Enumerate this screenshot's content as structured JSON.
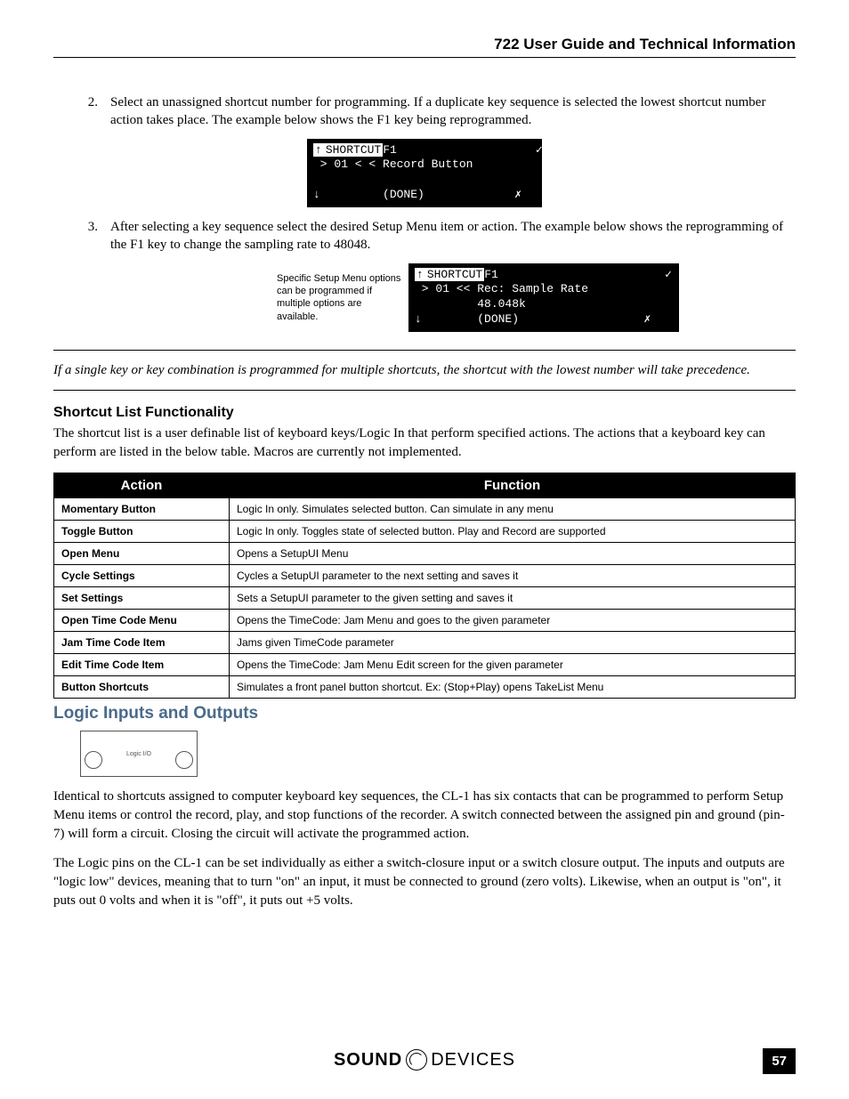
{
  "header_title": "722 User Guide and Technical Information",
  "steps": [
    {
      "num": "2.",
      "text": "Select an unassigned shortcut number for programming. If a duplicate key sequence is selected the lowest shortcut number action takes place. The example below shows the F1 key being reprogrammed."
    },
    {
      "num": "3.",
      "text": "After selecting a key sequence select the desired Setup Menu item or action. The example below shows the reprogramming of the F1 key to change the sampling rate to 48048."
    }
  ],
  "lcd1": {
    "line1a": "↑",
    "line1b": "SHORTCUT",
    "line1c": "F1",
    "line1d": "                    ✓",
    "line2": " > 01 < < Record Button",
    "line3": "↓         (DONE)             ✗"
  },
  "lcd2_caption": "Specific Setup Menu options can be programmed if multiple options are available.",
  "lcd2": {
    "line1a": "↑",
    "line1b": "SHORTCUT",
    "line1c": "F1",
    "line1d": "                        ✓",
    "line2": " > 01 << Rec: Sample Rate",
    "line3": "         48.048k",
    "line4": "↓        (DONE)                  ✗"
  },
  "note": "If a single key or key combination is programmed for multiple shortcuts, the shortcut with the lowest number will take precedence.",
  "shortcut_heading": "Shortcut List Functionality",
  "shortcut_intro": "The shortcut list is a user definable list of keyboard keys/Logic In that perform specified actions. The actions that a keyboard key can perform are listed in the below table.  Macros are currently not implemented.",
  "table": {
    "headers": [
      "Action",
      "Function"
    ],
    "rows": [
      [
        "Momentary Button",
        "Logic In only. Simulates selected button. Can simulate in any menu"
      ],
      [
        "Toggle Button",
        "Logic In only. Toggles state of selected button. Play and Record are supported"
      ],
      [
        "Open Menu",
        "Opens a SetupUI Menu"
      ],
      [
        "Cycle Settings",
        "Cycles a SetupUI parameter to the next setting and saves it"
      ],
      [
        "Set Settings",
        "Sets a SetupUI parameter to the given setting and saves it"
      ],
      [
        "Open Time Code Menu",
        "Opens the TimeCode: Jam Menu and goes to the given parameter"
      ],
      [
        "Jam Time Code Item",
        "Jams given TimeCode parameter"
      ],
      [
        "Edit Time Code Item",
        "Opens the TimeCode: Jam Menu Edit screen for the given parameter"
      ],
      [
        "Button Shortcuts",
        "Simulates a front panel button shortcut. Ex: (Stop+Play) opens TakeList Menu"
      ]
    ]
  },
  "logic_heading": "Logic Inputs and Outputs",
  "connector_label": "Logic I/O",
  "logic_p1": "Identical to shortcuts assigned to computer keyboard key sequences, the CL-1 has six contacts that can be programmed to perform Setup Menu items or control the record, play, and stop functions of the recorder. A switch connected between the assigned pin and ground (pin-7) will form a circuit. Closing the circuit will activate the programmed action.",
  "logic_p2": "The Logic pins on the CL-1 can be set individually as either a switch-closure input or a switch closure output. The inputs and outputs are \"logic low\" devices, meaning that to turn \"on\" an input, it must be connected to ground (zero volts). Likewise, when an output is \"on\", it puts out 0 volts and when it is \"off\", it puts out +5 volts.",
  "logo": {
    "brand": "SOUND",
    "suffix": "DEVICES"
  },
  "page_number": "57"
}
